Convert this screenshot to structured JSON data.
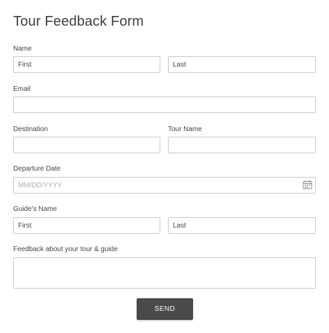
{
  "form": {
    "title": "Tour Feedback Form",
    "name": {
      "label": "Name",
      "first_placeholder": "First",
      "last_placeholder": "Last"
    },
    "email": {
      "label": "Email",
      "placeholder": ""
    },
    "destination": {
      "label": "Destination",
      "placeholder": ""
    },
    "tour_name": {
      "label": "Tour Name",
      "placeholder": ""
    },
    "departure_date": {
      "label": "Departure Date",
      "placeholder": "MM/DD/YYYY",
      "icon": "calendar-icon"
    },
    "guide_name": {
      "label": "Guide's Name",
      "first_placeholder": "First",
      "last_placeholder": "Last"
    },
    "feedback": {
      "label": "Feedback about your tour & guide",
      "placeholder": ""
    },
    "send_label": "SEND"
  },
  "colors": {
    "button_background": "#4a4a4a",
    "field_border": "#c9c9c9",
    "text": "#444444"
  }
}
